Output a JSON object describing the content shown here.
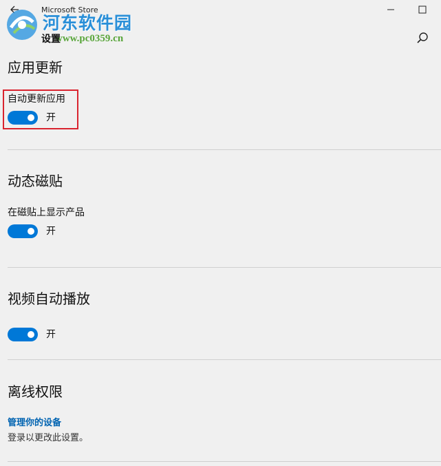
{
  "app": {
    "title": "Microsoft Store"
  },
  "header": {
    "page_title": "设置"
  },
  "watermark": {
    "title": "河东软件园",
    "url": "www.pc0359.cn"
  },
  "sections": [
    {
      "heading": "应用更新",
      "setting_label": "自动更新应用",
      "toggle_state": "开",
      "toggle_on": true
    },
    {
      "heading": "动态磁贴",
      "setting_label": "在磁贴上显示产品",
      "toggle_state": "开",
      "toggle_on": true
    },
    {
      "heading": "视频自动播放",
      "setting_label": "",
      "toggle_state": "开",
      "toggle_on": true
    },
    {
      "heading": "离线权限",
      "link": "管理你的设备",
      "sub_text": "登录以更改此设置。"
    }
  ],
  "colors": {
    "accent": "#0078d7",
    "highlight_border": "#d9232e",
    "link": "#0063b1",
    "background": "#f0f0f0"
  }
}
